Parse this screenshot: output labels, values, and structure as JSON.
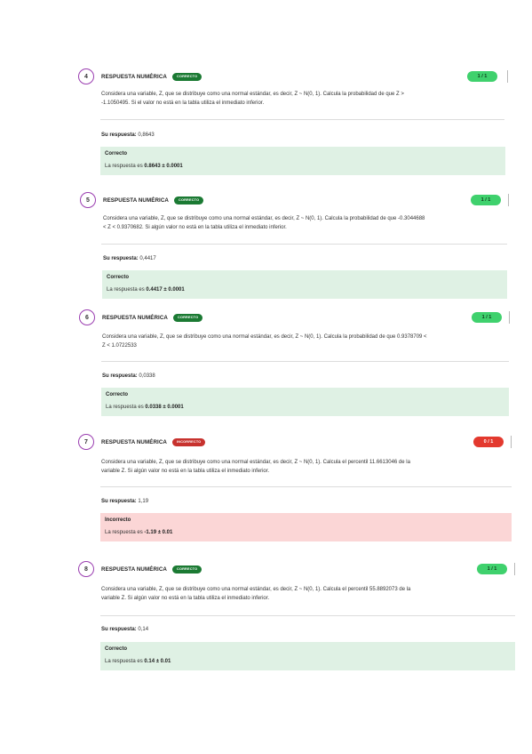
{
  "questions": [
    {
      "number": "4",
      "type": "RESPUESTA NUMÉRICA",
      "status": "CORRECTO",
      "score": "1 / 1",
      "text_line1": "Considera una variable, Z, que se distribuye como una normal estándar, es decir, Z ~ N(0, 1). Calcula la probabilidad de que Z >",
      "text_line2": "-1.1050495. Si el valor no está en la tabla utiliza el inmediato inferior.",
      "answer_label": "Su respuesta:",
      "answer_value": "0,8643",
      "feedback_title": "Correcto",
      "feedback_prefix": "La respuesta es",
      "feedback_value": "0.8643 ± 0.0001"
    },
    {
      "number": "5",
      "type": "RESPUESTA NUMÉRICA",
      "status": "CORRECTO",
      "score": "1 / 1",
      "text_line1": "Considera una variable, Z, que se distribuye como una normal estándar, es decir, Z ~ N(0, 1). Calcula la probabilidad de que -0.3044688",
      "text_line2": "< Z < 0.9370682. Si algún valor no está en la tabla utiliza el inmediato inferior.",
      "answer_label": "Su respuesta:",
      "answer_value": "0,4417",
      "feedback_title": "Correcto",
      "feedback_prefix": "La respuesta es",
      "feedback_value": "0.4417 ± 0.0001"
    },
    {
      "number": "6",
      "type": "RESPUESTA NUMÉRICA",
      "status": "CORRECTO",
      "score": "1 / 1",
      "text_line1": "Considera una variable, Z, que se distribuye como una normal estándar, es decir, Z ~ N(0, 1). Calcula la probabilidad de que 0.9378709 <",
      "text_line2": "Z < 1.0722533",
      "answer_label": "Su respuesta:",
      "answer_value": "0,0338",
      "feedback_title": "Correcto",
      "feedback_prefix": "La respuesta es",
      "feedback_value": "0.0338 ± 0.0001"
    },
    {
      "number": "7",
      "type": "RESPUESTA NUMÉRICA",
      "status": "INCORRECTO",
      "score": "0 / 1",
      "text_line1": "Considera una variable, Z, que se distribuye como una normal estándar, es decir, Z ~ N(0, 1). Calcula el percentil 11.6613046 de la",
      "text_line2": "variable Z. Si algún valor no está en la tabla utiliza el inmediato inferior.",
      "answer_label": "Su respuesta:",
      "answer_value": "1,19",
      "feedback_title": "Incorrecto",
      "feedback_prefix": "La respuesta es",
      "feedback_value": "-1.19 ± 0.01"
    },
    {
      "number": "8",
      "type": "RESPUESTA NUMÉRICA",
      "status": "CORRECTO",
      "score": "1 / 1",
      "text_line1": "Considera una variable, Z, que se distribuye como una normal estándar, es decir, Z ~ N(0, 1). Calcula el percentil 55.8892073 de la",
      "text_line2": "variable Z. Si algún valor no está en la tabla utiliza el inmediato inferior.",
      "answer_label": "Su respuesta:",
      "answer_value": "0,14",
      "feedback_title": "Correcto",
      "feedback_prefix": "La respuesta es",
      "feedback_value": "0.14 ± 0.01"
    }
  ],
  "colors": {
    "correct_badge": "#1b7a33",
    "incorrect_badge": "#c7322e",
    "correct_score": "#3fd16d",
    "incorrect_score": "#e3392e",
    "correct_feedback_bg": "#dff1e4",
    "incorrect_feedback_bg": "#fbd6d6",
    "number_circle_border": "#9a3db0"
  }
}
